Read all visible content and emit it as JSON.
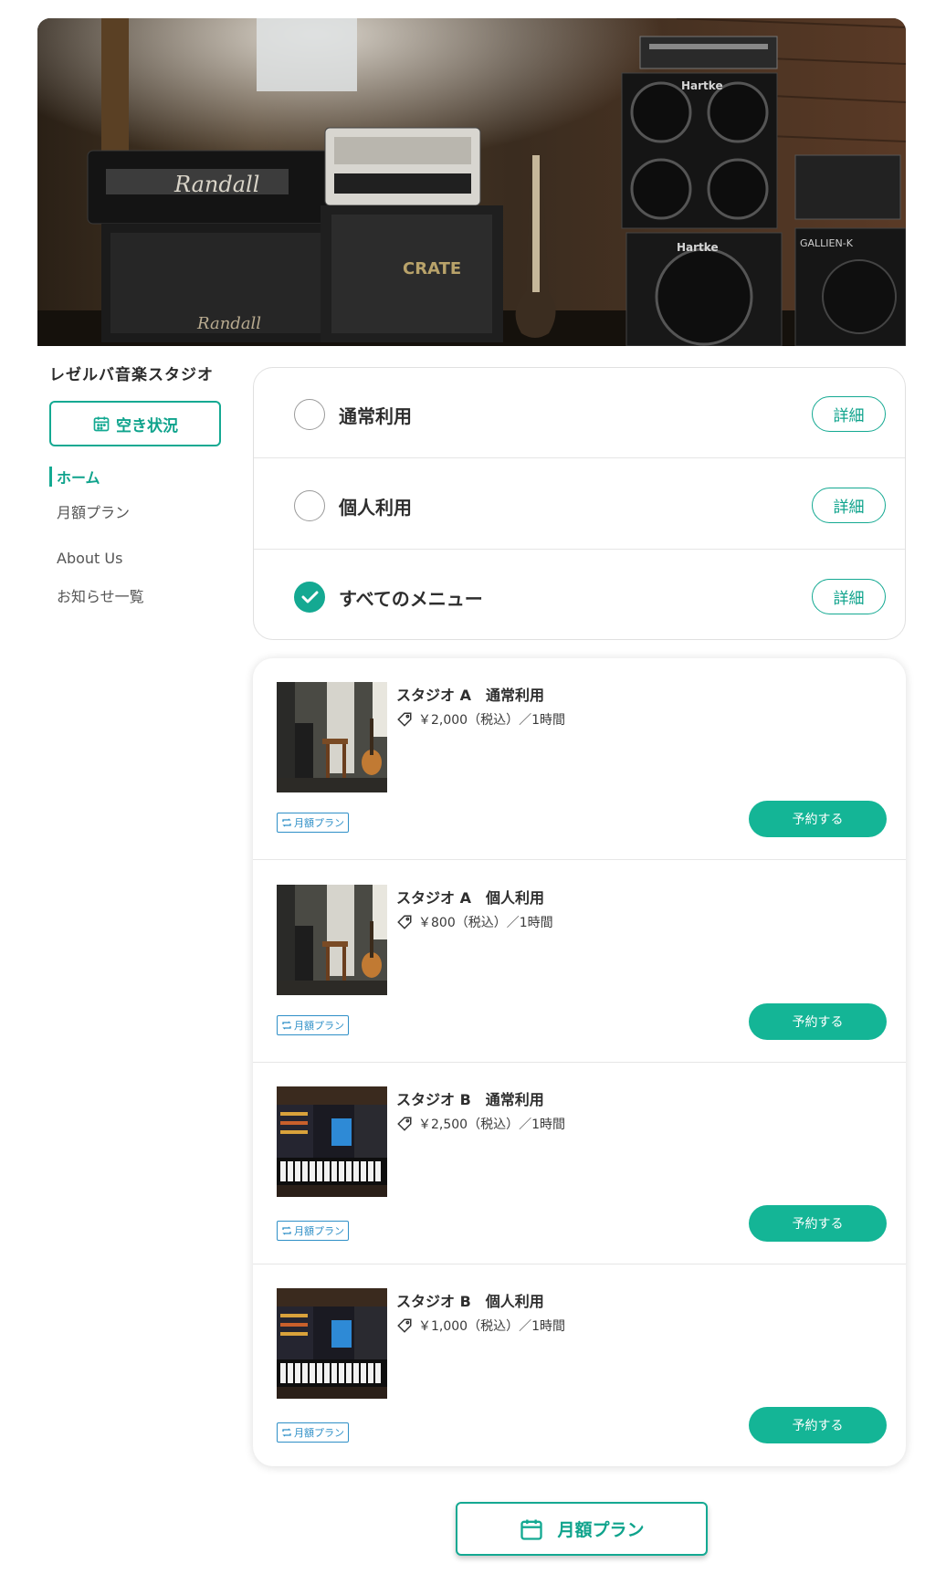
{
  "sidebar": {
    "studio_name": "レゼルバ音楽スタジオ",
    "availability_button": "空き状況",
    "nav": [
      {
        "label": "ホーム",
        "active": true
      },
      {
        "label": "月額プラン",
        "active": false
      },
      {
        "label": "About Us",
        "active": false
      },
      {
        "label": "お知らせ一覧",
        "active": false
      }
    ]
  },
  "filters": {
    "detail_label": "詳細",
    "options": [
      {
        "label": "通常利用",
        "checked": false
      },
      {
        "label": "個人利用",
        "checked": false
      },
      {
        "label": "すべてのメニュー",
        "checked": true
      }
    ]
  },
  "plans": [
    {
      "title": "スタジオ A　通常利用",
      "price": "￥2,000（税込）／1時間",
      "tag": "月額プラン",
      "button": "予約する",
      "thumb": "guitar-studio"
    },
    {
      "title": "スタジオ A　個人利用",
      "price": "￥800（税込）／1時間",
      "tag": "月額プラン",
      "button": "予約する",
      "thumb": "guitar-studio"
    },
    {
      "title": "スタジオ B　通常利用",
      "price": "￥2,500（税込）／1時間",
      "tag": "月額プラン",
      "button": "予約する",
      "thumb": "keyboard-studio"
    },
    {
      "title": "スタジオ B　個人利用",
      "price": "￥1,000（税込）／1時間",
      "tag": "月額プラン",
      "button": "予約する",
      "thumb": "keyboard-studio"
    }
  ],
  "footer": {
    "monthly_plan_button": "月額プラン"
  },
  "icons": {
    "calendar": "calendar-icon",
    "check": "check-icon",
    "price_tag": "price-tag-icon",
    "repeat": "repeat-icon"
  },
  "colors": {
    "accent": "#14a992",
    "button_fill": "#14b596",
    "tag_blue": "#2e8fc7"
  },
  "hero": {
    "logos": [
      "Randall",
      "Hartke",
      "Hartke",
      "CRATE",
      "GALLIEN-K"
    ]
  }
}
